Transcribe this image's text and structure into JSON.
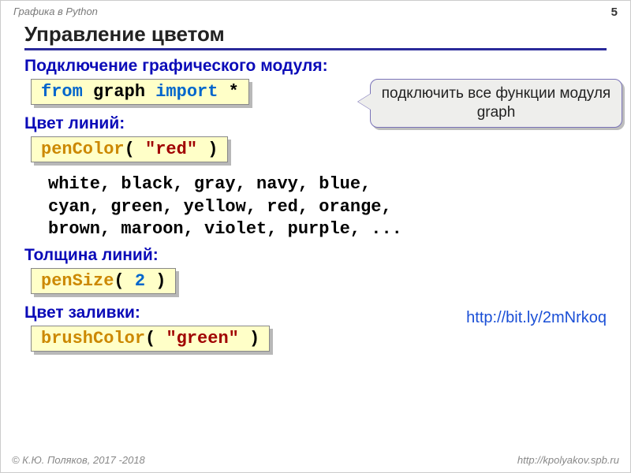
{
  "header": {
    "breadcrumb": "Графика в Python",
    "page_number": "5"
  },
  "title": "Управление цветом",
  "section1": {
    "heading": "Подключение графического модуля:",
    "code": {
      "kw1": "from",
      "mod": " graph ",
      "kw2": "import",
      "star": " *"
    }
  },
  "callout": "подключить все функции модуля graph",
  "section2": {
    "heading": "Цвет линий:",
    "code": {
      "fn": "penColor",
      "open": "( ",
      "arg": "\"red\"",
      "close": " )"
    }
  },
  "color_list": {
    "l1": "white, black, gray, navy, blue,",
    "l2": "cyan, green, yellow, red, orange,",
    "l3": "brown, maroon, violet, purple, ..."
  },
  "link": "http://bit.ly/2mNrkoq",
  "section3": {
    "heading": "Толщина линий:",
    "code": {
      "fn": "penSize",
      "open": "( ",
      "arg": "2",
      "close": " )"
    }
  },
  "section4": {
    "heading": "Цвет заливки:",
    "code": {
      "fn": "brushColor",
      "open": "( ",
      "arg": "\"green\"",
      "close": " )"
    }
  },
  "footer": {
    "left": "© К.Ю. Поляков, 2017 -2018",
    "right": "http://kpolyakov.spb.ru"
  }
}
